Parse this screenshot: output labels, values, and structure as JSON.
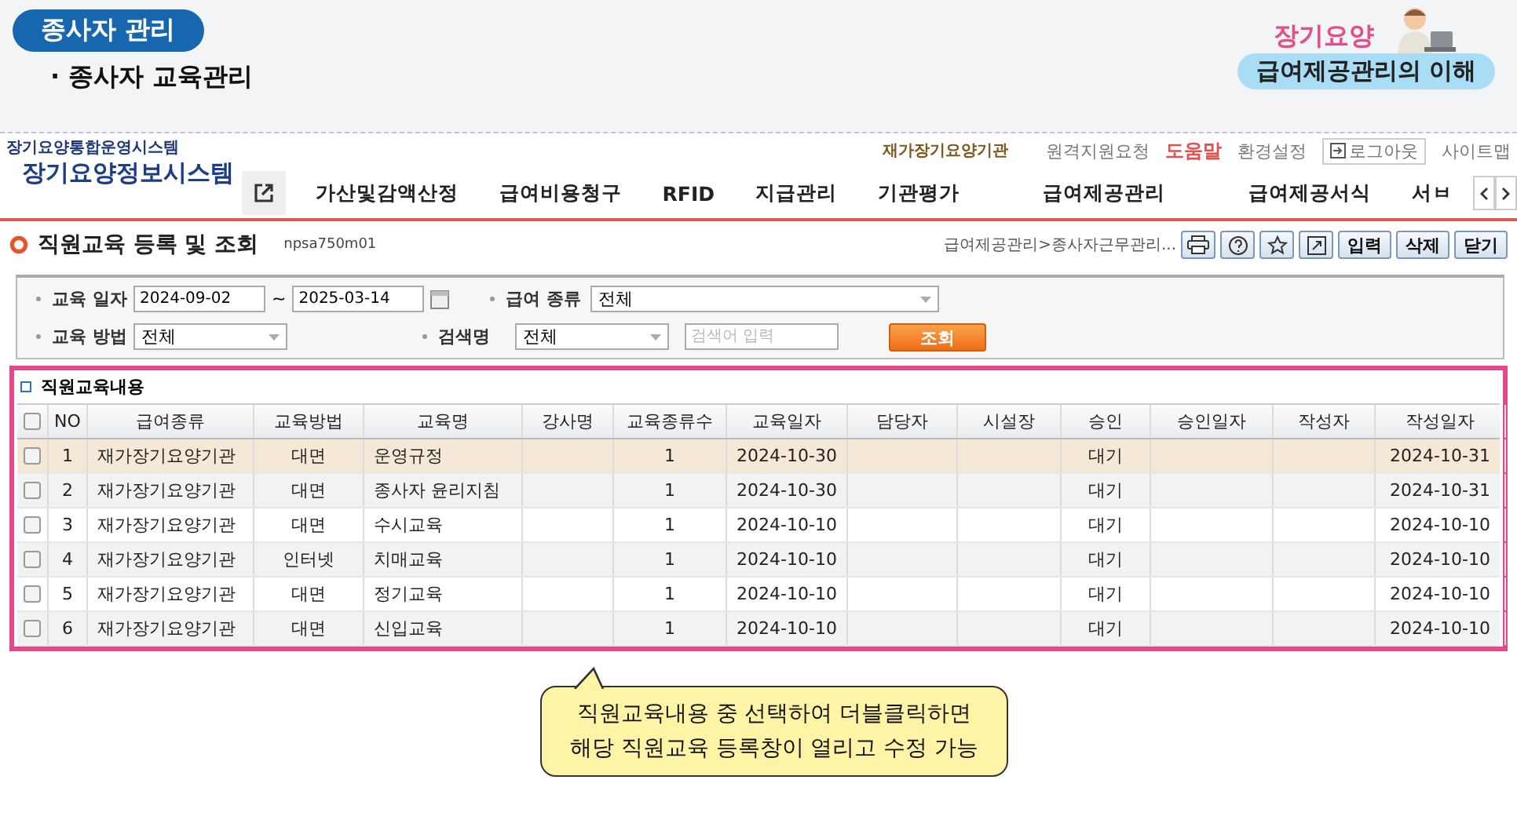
{
  "banner": {
    "badge": "종사자 관리",
    "subtitle": "· 종사자 교육관리",
    "brand_top": "장기요양",
    "brand_pill": "급여제공관리의 이해"
  },
  "header": {
    "system_small": "장기요양통합운영시스템",
    "system_title": "장기요양정보시스템",
    "org": "재가장기요양기관",
    "links": [
      {
        "label": "원격지원요청",
        "kind": "plain"
      },
      {
        "label": "도움말",
        "kind": "help"
      },
      {
        "label": "환경설정",
        "kind": "plain"
      },
      {
        "label": "로그아웃",
        "kind": "logout"
      },
      {
        "label": "사이트맵",
        "kind": "plain"
      }
    ],
    "menu": [
      "가산및감액산정",
      "급여비용청구",
      "RFID",
      "지급관리",
      "기관평가",
      "급여제공관리",
      "급여제공서식",
      "서ㅂ"
    ]
  },
  "page": {
    "title": "직원교육 등록 및 조회",
    "code": "npsa750m01",
    "breadcrumb": "급여제공관리>종사자근무관리...",
    "buttons": [
      "입력",
      "삭제",
      "닫기"
    ]
  },
  "filters": {
    "date_label": "교육 일자",
    "date_from": "2024-09-02",
    "tilde": "~",
    "date_to": "2025-03-14",
    "benefit_label": "급여 종류",
    "benefit_value": "전체",
    "method_label": "교육 방법",
    "method_value": "전체",
    "search_label": "검색명",
    "search_value": "전체",
    "search_placeholder": "검색어 입력",
    "search_button": "조회"
  },
  "table": {
    "title": "직원교육내용",
    "header_checked": false,
    "columns": [
      "NO",
      "급여종류",
      "교육방법",
      "교육명",
      "강사명",
      "교육종류수",
      "교육일자",
      "담당자",
      "시설장",
      "승인",
      "승인일자",
      "작성자",
      "작성일자"
    ],
    "rows": [
      {
        "selected": true,
        "checked": false,
        "cells": [
          "1",
          "재가장기요양기관",
          "대면",
          "운영규정",
          "",
          "1",
          "2024-10-30",
          "",
          "",
          "대기",
          "",
          "",
          "2024-10-31"
        ]
      },
      {
        "selected": false,
        "checked": false,
        "cells": [
          "2",
          "재가장기요양기관",
          "대면",
          "종사자 윤리지침",
          "",
          "1",
          "2024-10-30",
          "",
          "",
          "대기",
          "",
          "",
          "2024-10-31"
        ]
      },
      {
        "selected": false,
        "checked": false,
        "cells": [
          "3",
          "재가장기요양기관",
          "대면",
          "수시교육",
          "",
          "1",
          "2024-10-10",
          "",
          "",
          "대기",
          "",
          "",
          "2024-10-10"
        ]
      },
      {
        "selected": false,
        "checked": false,
        "cells": [
          "4",
          "재가장기요양기관",
          "인터넷",
          "치매교육",
          "",
          "1",
          "2024-10-10",
          "",
          "",
          "대기",
          "",
          "",
          "2024-10-10"
        ]
      },
      {
        "selected": false,
        "checked": false,
        "cells": [
          "5",
          "재가장기요양기관",
          "대면",
          "정기교육",
          "",
          "1",
          "2024-10-10",
          "",
          "",
          "대기",
          "",
          "",
          "2024-10-10"
        ]
      },
      {
        "selected": false,
        "checked": false,
        "cells": [
          "6",
          "재가장기요양기관",
          "대면",
          "신입교육",
          "",
          "1",
          "2024-10-10",
          "",
          "",
          "대기",
          "",
          "",
          "2024-10-10"
        ]
      }
    ]
  },
  "callout": [
    "직원교육내용 중 선택하여 더블클릭하면",
    "해당 직원교육 등록창이 열리고 수정 가능"
  ]
}
